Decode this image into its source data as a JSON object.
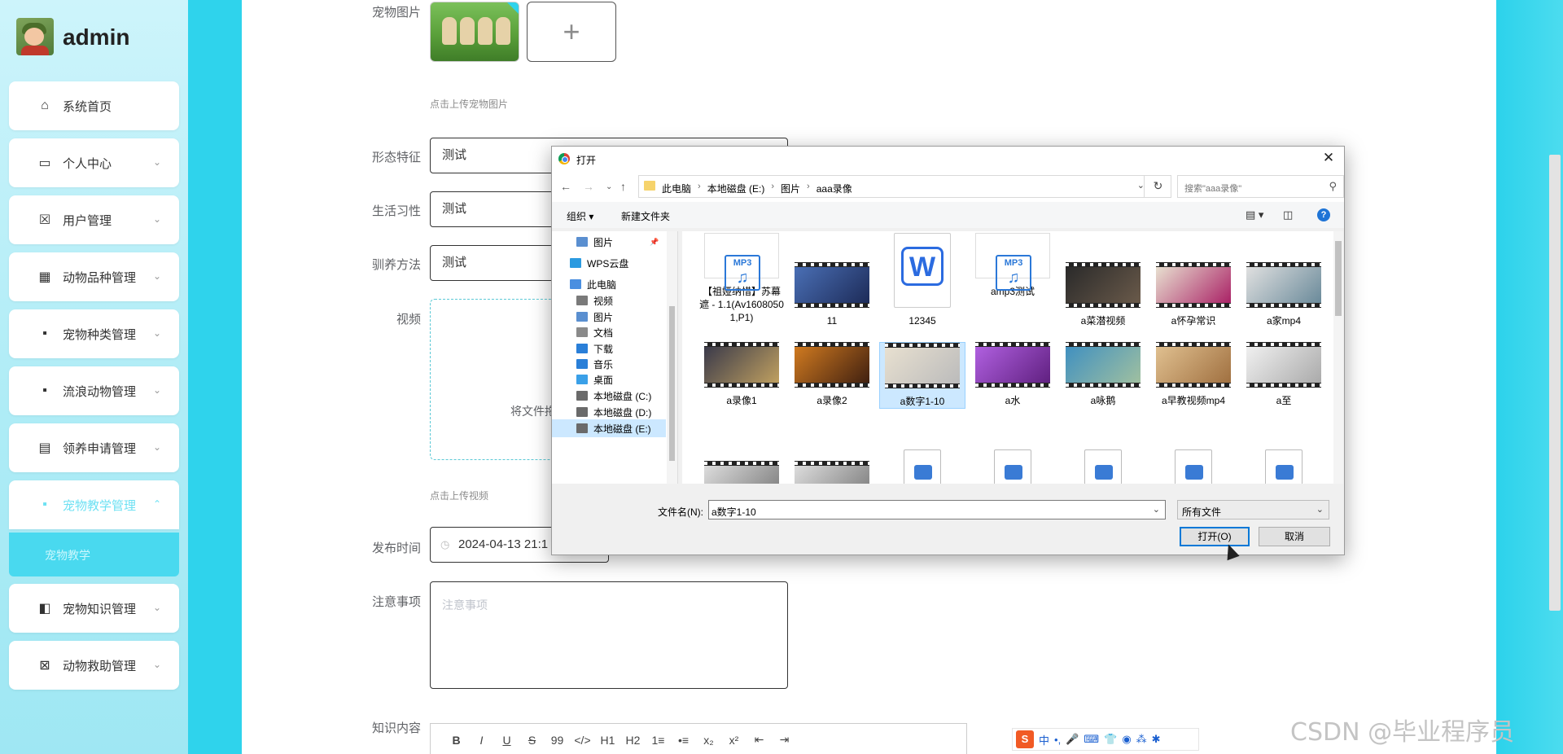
{
  "sidebar": {
    "username": "admin",
    "items": [
      {
        "label": "系统首页",
        "icon": "home-icon",
        "glyph": "⌂"
      },
      {
        "label": "个人中心",
        "icon": "wallet-icon",
        "glyph": "▭"
      },
      {
        "label": "用户管理",
        "icon": "clipboard-x-icon",
        "glyph": "☒"
      },
      {
        "label": "动物品种管理",
        "icon": "grid9-icon",
        "glyph": "▦"
      },
      {
        "label": "宠物种类管理",
        "icon": "grid4-icon",
        "glyph": "▪"
      },
      {
        "label": "流浪动物管理",
        "icon": "grid4-icon",
        "glyph": "▪"
      },
      {
        "label": "领养申请管理",
        "icon": "clipboard-icon",
        "glyph": "▤"
      },
      {
        "label": "宠物教学管理",
        "icon": "grid4-icon",
        "glyph": "▪"
      },
      {
        "label": "宠物知识管理",
        "icon": "wallet-icon",
        "glyph": "◧"
      },
      {
        "label": "动物救助管理",
        "icon": "ticket-icon",
        "glyph": "⊠"
      }
    ],
    "submenu_label": "宠物教学"
  },
  "form": {
    "pet_image_label": "宠物图片",
    "pet_image_hint": "点击上传宠物图片",
    "features_label": "形态特征",
    "features_value": "测试",
    "habits_label": "生活习性",
    "habits_value": "测试",
    "training_label": "驯养方法",
    "training_value": "测试",
    "video_label": "视频",
    "video_drop_text": "将文件拖",
    "video_hint": "点击上传视频",
    "publish_time_label": "发布时间",
    "publish_time_value": "2024-04-13 21:1",
    "notes_label": "注意事项",
    "notes_placeholder": "注意事项",
    "content_label": "知识内容",
    "editor_tools": [
      "B",
      "I",
      "U",
      "S",
      "99",
      "</>",
      "H1",
      "H2",
      "1≡",
      "•≡",
      "x₂",
      "x²",
      "⇤",
      "⇥"
    ]
  },
  "dialog": {
    "title": "打开",
    "breadcrumbs": [
      "此电脑",
      "本地磁盘 (E:)",
      "图片",
      "aaa录像"
    ],
    "search_placeholder": "搜索\"aaa录像\"",
    "organize_label": "组织 ▾",
    "new_folder_label": "新建文件夹",
    "nav_items": [
      {
        "label": "图片",
        "color": "#5a8fd0",
        "indent": true
      },
      {
        "label": "WPS云盘",
        "color": "#2b9ae0",
        "indent": false
      },
      {
        "label": "此电脑",
        "color": "#4a8fe0",
        "indent": false
      },
      {
        "label": "视频",
        "color": "#7a7a7a",
        "indent": true
      },
      {
        "label": "图片",
        "color": "#5a8fd0",
        "indent": true
      },
      {
        "label": "文档",
        "color": "#8a8a8a",
        "indent": true
      },
      {
        "label": "下载",
        "color": "#2a7fd8",
        "indent": true
      },
      {
        "label": "音乐",
        "color": "#2a7fd8",
        "indent": true
      },
      {
        "label": "桌面",
        "color": "#3aa0e8",
        "indent": true
      },
      {
        "label": "本地磁盘 (C:)",
        "color": "#6a6a6a",
        "indent": true
      },
      {
        "label": "本地磁盘 (D:)",
        "color": "#6a6a6a",
        "indent": true
      },
      {
        "label": "本地磁盘 (E:)",
        "color": "#6a6a6a",
        "indent": true
      }
    ],
    "files_row1": [
      {
        "label": "【祖娅纳惜】苏幕遮 - 1.1(Av16080501,P1)",
        "kind": "mp3"
      },
      {
        "label": "11",
        "kind": "video"
      },
      {
        "label": "12345",
        "kind": "wps"
      },
      {
        "label": "amp3测试",
        "kind": "mp3"
      },
      {
        "label": "a菜潜视频",
        "kind": "video"
      },
      {
        "label": "a怀孕常识",
        "kind": "video"
      },
      {
        "label": "a家mp4",
        "kind": "video"
      }
    ],
    "files_row2": [
      {
        "label": "a录像1",
        "kind": "video"
      },
      {
        "label": "a录像2",
        "kind": "video"
      },
      {
        "label": "a数字1-10",
        "kind": "video"
      },
      {
        "label": "a水",
        "kind": "video"
      },
      {
        "label": "a咏鹅",
        "kind": "video"
      },
      {
        "label": "a早教视频mp4",
        "kind": "video"
      },
      {
        "label": "a至",
        "kind": "video"
      }
    ],
    "mp3_tag": "MP3",
    "filename_label": "文件名(N):",
    "filename_value": "a数字1-10",
    "filetype_value": "所有文件",
    "open_button": "打开(O)",
    "cancel_button": "取消"
  },
  "ime": {
    "items": [
      "中",
      "•,",
      "🎤",
      "⌨",
      "👕",
      "◉",
      "⁂",
      "✱"
    ]
  },
  "watermark": "CSDN @毕业程序员"
}
